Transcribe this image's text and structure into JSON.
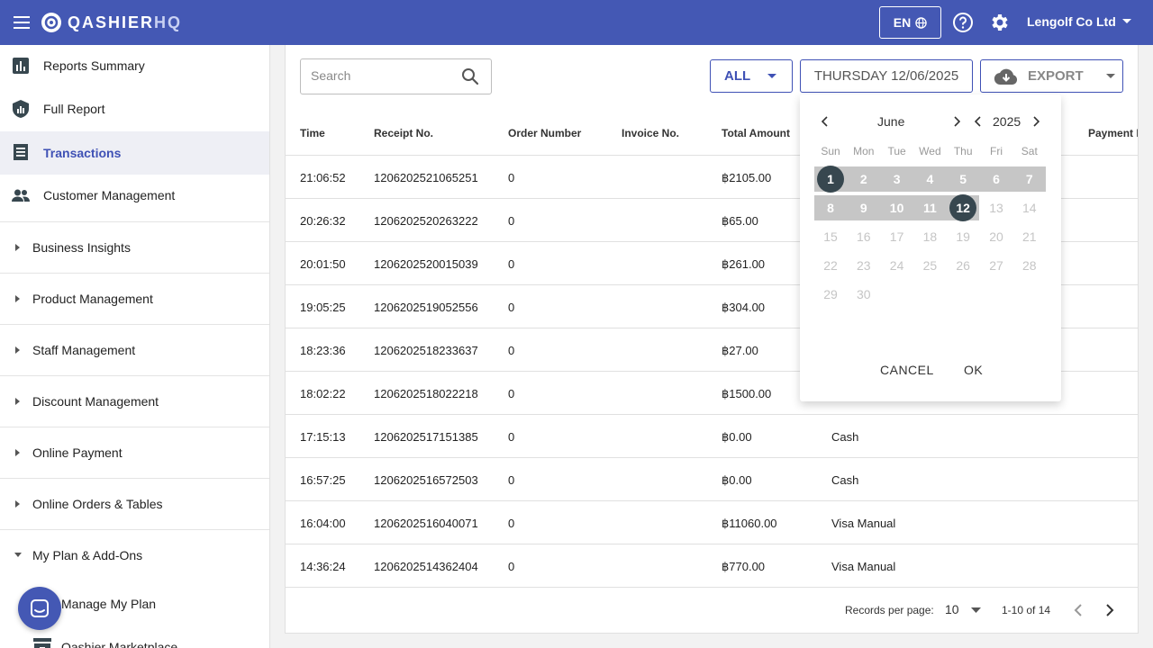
{
  "header": {
    "logo": "QASHIER",
    "logo_suffix": "HQ",
    "language": "EN",
    "company": "Lengolf Co Ltd"
  },
  "sidebar": {
    "items": [
      {
        "label": "Reports Summary",
        "icon": "bar-chart-icon"
      },
      {
        "label": "Full Report",
        "icon": "report-shield-icon"
      },
      {
        "label": "Transactions",
        "icon": "receipt-icon",
        "active": true
      },
      {
        "label": "Customer Management",
        "icon": "people-icon"
      }
    ],
    "groups": [
      "Business Insights",
      "Product Management",
      "Staff Management",
      "Discount Management",
      "Online Payment",
      "Online Orders & Tables",
      "My Plan & Add-Ons"
    ],
    "subitems": [
      "Manage My Plan",
      "Qashier Marketplace"
    ]
  },
  "toolbar": {
    "search_placeholder": "Search",
    "filter": "ALL",
    "date": "THURSDAY 12/06/2025",
    "export": "EXPORT"
  },
  "table": {
    "columns": [
      "Time",
      "Receipt No.",
      "Order Number",
      "Invoice No.",
      "Total Amount",
      "Payment N"
    ],
    "rows": [
      {
        "time": "21:06:52",
        "receipt": "1206202521065251",
        "order": "0",
        "amount": "฿2105.00",
        "payment": ""
      },
      {
        "time": "20:26:32",
        "receipt": "1206202520263222",
        "order": "0",
        "amount": "฿65.00",
        "payment": ""
      },
      {
        "time": "20:01:50",
        "receipt": "1206202520015039",
        "order": "0",
        "amount": "฿261.00",
        "payment": ""
      },
      {
        "time": "19:05:25",
        "receipt": "1206202519052556",
        "order": "0",
        "amount": "฿304.00",
        "payment": ""
      },
      {
        "time": "18:23:36",
        "receipt": "1206202518233637",
        "order": "0",
        "amount": "฿27.00",
        "payment": ""
      },
      {
        "time": "18:02:22",
        "receipt": "1206202518022218",
        "order": "0",
        "amount": "฿1500.00",
        "payment": ""
      },
      {
        "time": "17:15:13",
        "receipt": "1206202517151385",
        "order": "0",
        "amount": "฿0.00",
        "payment": "Cash"
      },
      {
        "time": "16:57:25",
        "receipt": "1206202516572503",
        "order": "0",
        "amount": "฿0.00",
        "payment": "Cash"
      },
      {
        "time": "16:04:00",
        "receipt": "1206202516040071",
        "order": "0",
        "amount": "฿11060.00",
        "payment": "Visa Manual"
      },
      {
        "time": "14:36:24",
        "receipt": "1206202514362404",
        "order": "0",
        "amount": "฿770.00",
        "payment": "Visa Manual"
      }
    ],
    "records_per_page_label": "Records per page:",
    "records_per_page": "10",
    "range": "1-10 of 14"
  },
  "calendar": {
    "month": "June",
    "year": "2025",
    "weekdays": [
      "Sun",
      "Mon",
      "Tue",
      "Wed",
      "Thu",
      "Fri",
      "Sat"
    ],
    "days": [
      "1",
      "2",
      "3",
      "4",
      "5",
      "6",
      "7",
      "8",
      "9",
      "10",
      "11",
      "12",
      "13",
      "14",
      "15",
      "16",
      "17",
      "18",
      "19",
      "20",
      "21",
      "22",
      "23",
      "24",
      "25",
      "26",
      "27",
      "28",
      "29",
      "30"
    ],
    "range_start": 1,
    "range_end": 12,
    "cancel": "CANCEL",
    "ok": "OK"
  },
  "colors": {
    "brand": "#4458b4",
    "accent": "#3f51b5",
    "range": "#c6c6c6",
    "selected": "#37474f"
  }
}
